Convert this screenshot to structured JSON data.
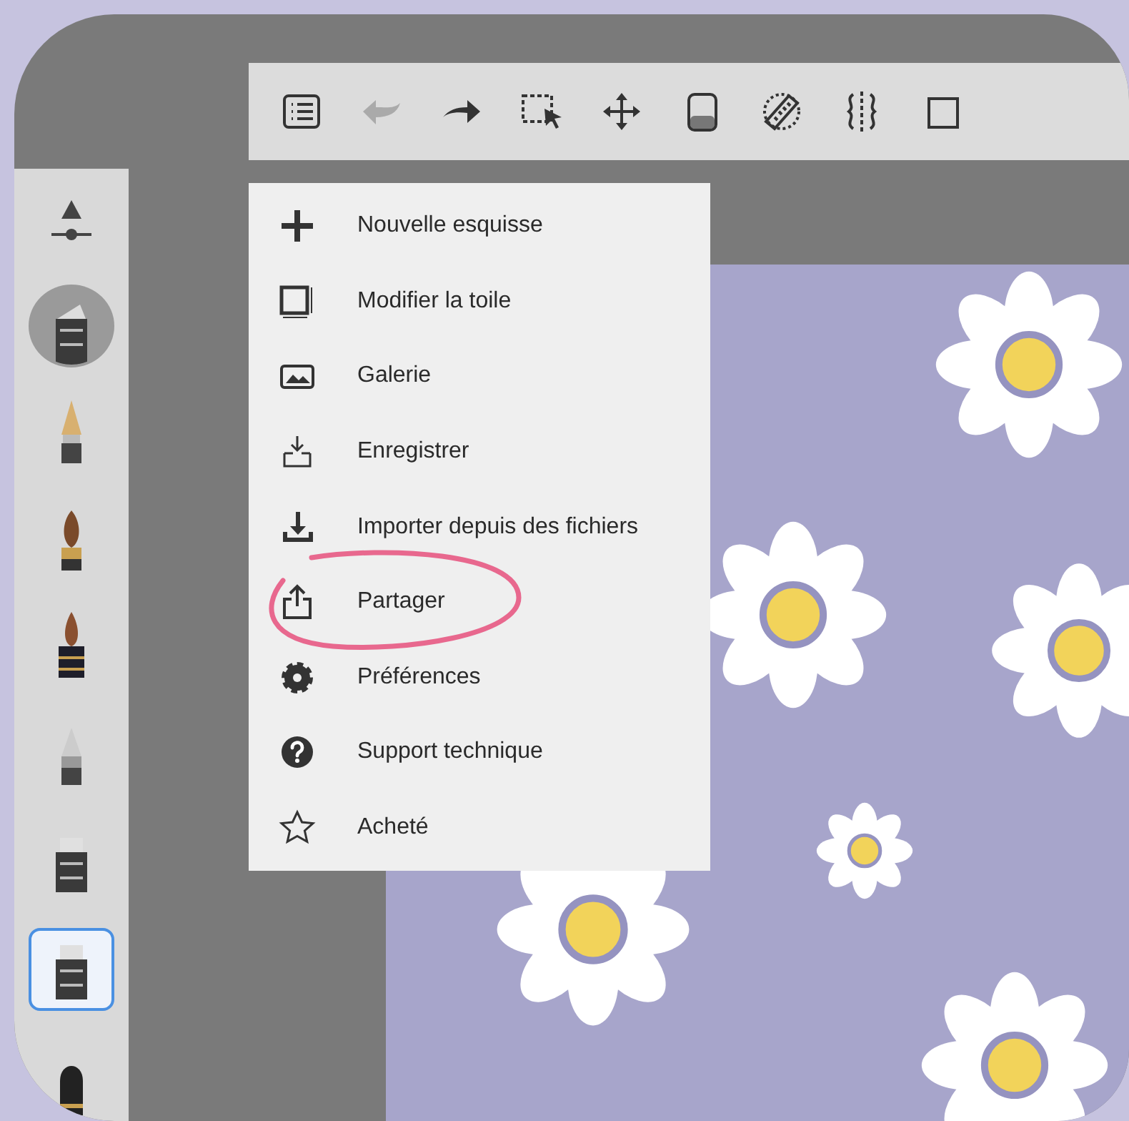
{
  "toolbar": {
    "items": [
      {
        "kind": "list",
        "disabled": false
      },
      {
        "kind": "undo",
        "disabled": true
      },
      {
        "kind": "redo",
        "disabled": false
      },
      {
        "kind": "select",
        "disabled": false
      },
      {
        "kind": "move",
        "disabled": false
      },
      {
        "kind": "bucket",
        "disabled": false
      },
      {
        "kind": "ruler",
        "disabled": false
      },
      {
        "kind": "symmetry",
        "disabled": false
      },
      {
        "kind": "square",
        "disabled": false
      }
    ]
  },
  "sidebar": {
    "items": [
      {
        "kind": "size",
        "selected": false
      },
      {
        "kind": "current",
        "selected": false
      },
      {
        "kind": "nib",
        "selected": false
      },
      {
        "kind": "brush",
        "selected": false
      },
      {
        "kind": "ink",
        "selected": false
      },
      {
        "kind": "pencil",
        "selected": false
      },
      {
        "kind": "marker",
        "selected": false
      },
      {
        "kind": "marker",
        "selected": true
      },
      {
        "kind": "stub",
        "selected": false
      }
    ]
  },
  "menu": {
    "items": [
      {
        "kind": "plus",
        "label": "Nouvelle esquisse"
      },
      {
        "kind": "canvas",
        "label": "Modifier la toile"
      },
      {
        "kind": "gallery",
        "label": "Galerie"
      },
      {
        "kind": "save",
        "label": "Enregistrer"
      },
      {
        "kind": "import",
        "label": "Importer depuis des fichiers"
      },
      {
        "kind": "share",
        "label": "Partager"
      },
      {
        "kind": "gear",
        "label": "Préférences"
      },
      {
        "kind": "help",
        "label": "Support technique"
      },
      {
        "kind": "star",
        "label": "Acheté"
      }
    ]
  }
}
